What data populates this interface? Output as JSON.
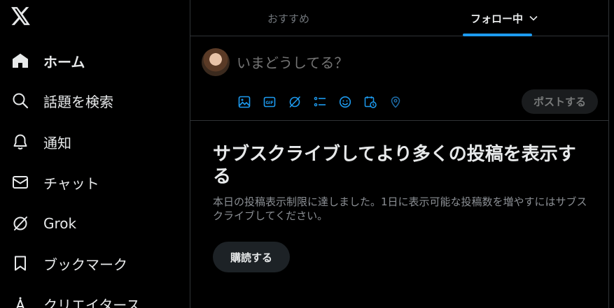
{
  "sidebar": {
    "logo": "x-logo-icon",
    "items": [
      {
        "label": "ホーム",
        "icon": "home-icon",
        "active": true
      },
      {
        "label": "話題を検索",
        "icon": "search-icon"
      },
      {
        "label": "通知",
        "icon": "bell-icon"
      },
      {
        "label": "チャット",
        "icon": "mail-icon"
      },
      {
        "label": "Grok",
        "icon": "grok-icon"
      },
      {
        "label": "ブックマーク",
        "icon": "bookmark-icon"
      },
      {
        "label": "クリエイタース",
        "icon": "creator-icon"
      }
    ]
  },
  "tabs": {
    "recommended": "おすすめ",
    "following": "フォロー中"
  },
  "composer": {
    "placeholder": "いまどうしてる？",
    "post_label": "ポストする",
    "tools": [
      "image-icon",
      "gif-icon",
      "grok-icon",
      "poll-icon",
      "emoji-icon",
      "schedule-icon",
      "location-icon"
    ]
  },
  "subscribe": {
    "title": "サブスクライブしてより多くの投稿を表示する",
    "description": "本日の投稿表示制限に達しました。1日に表示可能な投稿数を増やすにはサブスクライブしてください。",
    "button_label": "購読する"
  },
  "colors": {
    "accent": "#1d9bf0",
    "background": "#000000",
    "text": "#e7e9ea",
    "muted": "#71767b"
  }
}
